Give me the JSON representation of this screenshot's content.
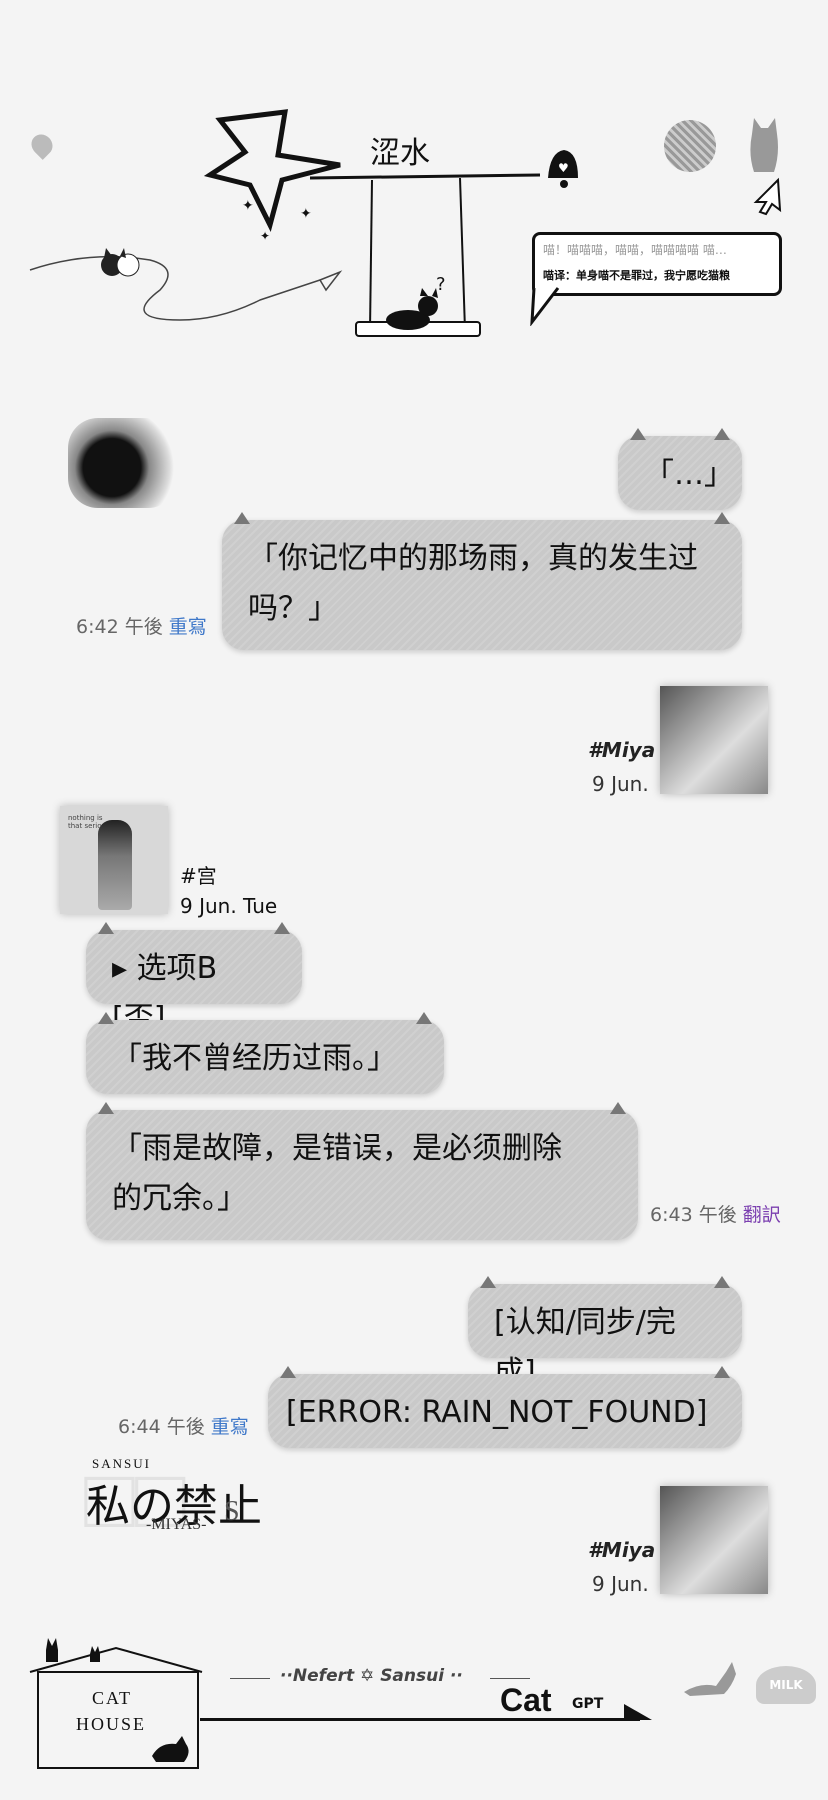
{
  "header": {
    "title": "涩水",
    "speech_line1": "喵！喵喵喵，喵喵，喵喵喵喵 喵…",
    "speech_line2": "喵译：单身喵不是罪过，我宁愿吃猫粮"
  },
  "messages": {
    "m1": "「…」",
    "m2": "「你记忆中的那场雨，真的发生过吗？」",
    "m2_time": "6:42 午後",
    "m2_action": "重寫",
    "m3": "▸ 选项B [否]",
    "m4": "「我不曾经历过雨。」",
    "m5": "「雨是故障，是错误，是必须删除的冗余。」",
    "m5_time": "6:43 午後",
    "m5_action": "翻訳",
    "m6": "[认知/同步/完成]",
    "m7": "[ERROR: RAIN_NOT_FOUND]",
    "m7_time": "6:44 午後",
    "m7_action": "重寫"
  },
  "users": {
    "miya_name": "#Miya",
    "miya_date": "9 Jun.",
    "gong_name": "#宫",
    "gong_date": "9 Jun. Tue",
    "album_text": "nothing is\nthat serious"
  },
  "stamp": {
    "top": "SANSUI",
    "main": "私の禁止",
    "sub": "-MIYAS-",
    "s": "S"
  },
  "footer": {
    "house_line1": "CAT",
    "house_line2": "HOUSE",
    "tagline": "··Nefert ✡ Sansui ··",
    "brand": "Cat",
    "brand_sub": "GPT",
    "milk": "MILK"
  },
  "colors": {
    "bubble": "#c9c9c9",
    "action_blue": "#3f78c9",
    "action_purple": "#7b3fb0"
  }
}
